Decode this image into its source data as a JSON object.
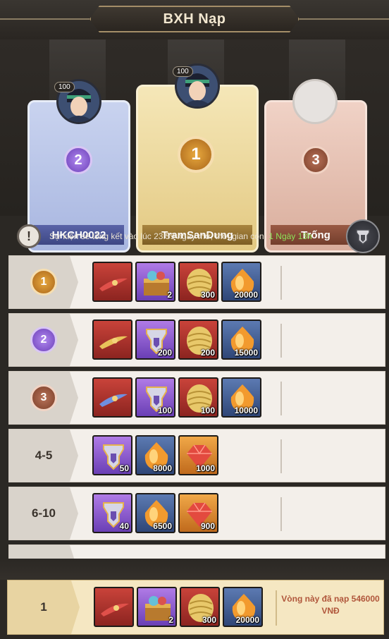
{
  "header": {
    "title": "BXH Nạp"
  },
  "podium": [
    {
      "rank": "2",
      "name": "HKCH0022",
      "level": "100"
    },
    {
      "rank": "1",
      "name": "TrạmSanDung",
      "level": "100"
    },
    {
      "rank": "3",
      "name": "Trống"
    }
  ],
  "notice": {
    "text": "Sự kiện sẽ tổng kết vào lúc 23:59 ngày mở, thời gian còn: ",
    "remaining": "1 Ngày 13h"
  },
  "rows": [
    {
      "rank": "1",
      "items": [
        {
          "icon": "red-feather-icon",
          "qty": ""
        },
        {
          "icon": "treasure-chest-icon",
          "qty": "2"
        },
        {
          "icon": "golden-scale-icon",
          "qty": "300"
        },
        {
          "icon": "gold-orb-icon",
          "qty": "20000"
        }
      ]
    },
    {
      "rank": "2",
      "items": [
        {
          "icon": "golden-feather-icon",
          "qty": ""
        },
        {
          "icon": "crest-shard-icon",
          "qty": "200"
        },
        {
          "icon": "golden-scale-icon",
          "qty": "200"
        },
        {
          "icon": "gold-orb-icon",
          "qty": "15000"
        }
      ]
    },
    {
      "rank": "3",
      "items": [
        {
          "icon": "blue-feather-icon",
          "qty": ""
        },
        {
          "icon": "crest-shard-icon",
          "qty": "100"
        },
        {
          "icon": "golden-scale-icon",
          "qty": "100"
        },
        {
          "icon": "gold-orb-icon",
          "qty": "10000"
        }
      ]
    },
    {
      "rank": "4-5",
      "items": [
        {
          "icon": "crest-shard-icon",
          "qty": "50"
        },
        {
          "icon": "gold-orb-icon",
          "qty": "8000"
        },
        {
          "icon": "red-gem-icon",
          "qty": "1000"
        }
      ]
    },
    {
      "rank": "6-10",
      "items": [
        {
          "icon": "crest-shard-icon",
          "qty": "40"
        },
        {
          "icon": "gold-orb-icon",
          "qty": "6500"
        },
        {
          "icon": "red-gem-icon",
          "qty": "900"
        }
      ]
    }
  ],
  "my_row": {
    "rank": "1",
    "items": [
      {
        "icon": "red-feather-icon",
        "qty": ""
      },
      {
        "icon": "treasure-chest-icon",
        "qty": "2"
      },
      {
        "icon": "golden-scale-icon",
        "qty": "300"
      },
      {
        "icon": "gold-orb-icon",
        "qty": "20000"
      }
    ],
    "message": "Vòng này đã nạp 546000 VNĐ"
  }
}
